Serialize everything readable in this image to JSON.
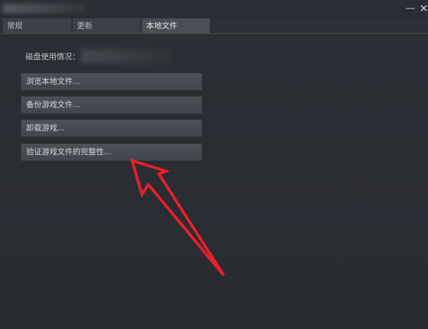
{
  "window": {
    "minimize_glyph": "—",
    "close_glyph": "✕"
  },
  "tabs": [
    {
      "label": "常规"
    },
    {
      "label": "更新"
    },
    {
      "label": "本地文件"
    }
  ],
  "local_files": {
    "disk_usage_label": "磁盘使用情况：",
    "buttons": [
      {
        "label": "浏览本地文件..."
      },
      {
        "label": "备份游戏文件..."
      },
      {
        "label": "卸载游戏..."
      },
      {
        "label": "验证游戏文件的完整性..."
      }
    ]
  },
  "colors": {
    "background": "#2b2e34",
    "button": "#4a4d54",
    "active_tab": "#4b4e55",
    "annotation_arrow": "#e8202a"
  }
}
